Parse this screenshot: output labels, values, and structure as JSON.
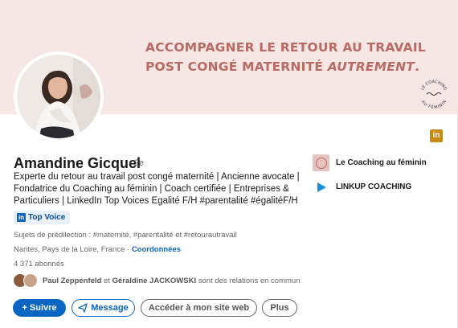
{
  "banner": {
    "line1": "ACCOMPAGNER LE RETOUR AU TRAVAIL",
    "line2_prefix": "POST CONGÉ MATERNITÉ ",
    "line2_emphasis": "AUTREMENT",
    "line2_suffix": ".",
    "seal_top": "LE COACHING",
    "seal_bottom": "AU FÉMININ",
    "color": "#b86a64",
    "background": "#f6e6e4"
  },
  "profile": {
    "name": "Amandine Gicquel",
    "degree": "· 2e",
    "headline": "Experte du retour au travail post congé maternité | Ancienne avocate | Fondatrice du Coaching au féminin | Coach certifiée | Entreprises & Particuliers | LinkedIn Top Voices Egalité F/H #parentalité #égalitéF/H",
    "top_voice_icon": "in",
    "top_voice": "Top Voice",
    "topics": "Sujets de prédilection : #maternité, #parentalité et #retourautravail",
    "location": "Nantes, Pays de la Loire, France",
    "location_sep": " · ",
    "contact_link": "Coordonnées",
    "followers": "4 371 abonnés",
    "mutual_name1": "Paul Zeppenfeld",
    "mutual_and": " et ",
    "mutual_name2": "Géraldine JACKOWSKI",
    "mutual_suffix": " sont des relations en commun"
  },
  "actions": {
    "follow": "+ Suivre",
    "message": "Message",
    "website": "Accéder à mon site web",
    "more": "Plus"
  },
  "sidebar": {
    "company": "Le Coaching au féminin",
    "school": "LINKUP COACHING"
  },
  "linkedin_badge": "in",
  "colors": {
    "accent": "#0a66c2",
    "badge": "#c98a15"
  },
  "icons": {
    "message": "paper-plane-icon",
    "school": "play-arrow-icon",
    "premium": "linkedin-icon"
  }
}
